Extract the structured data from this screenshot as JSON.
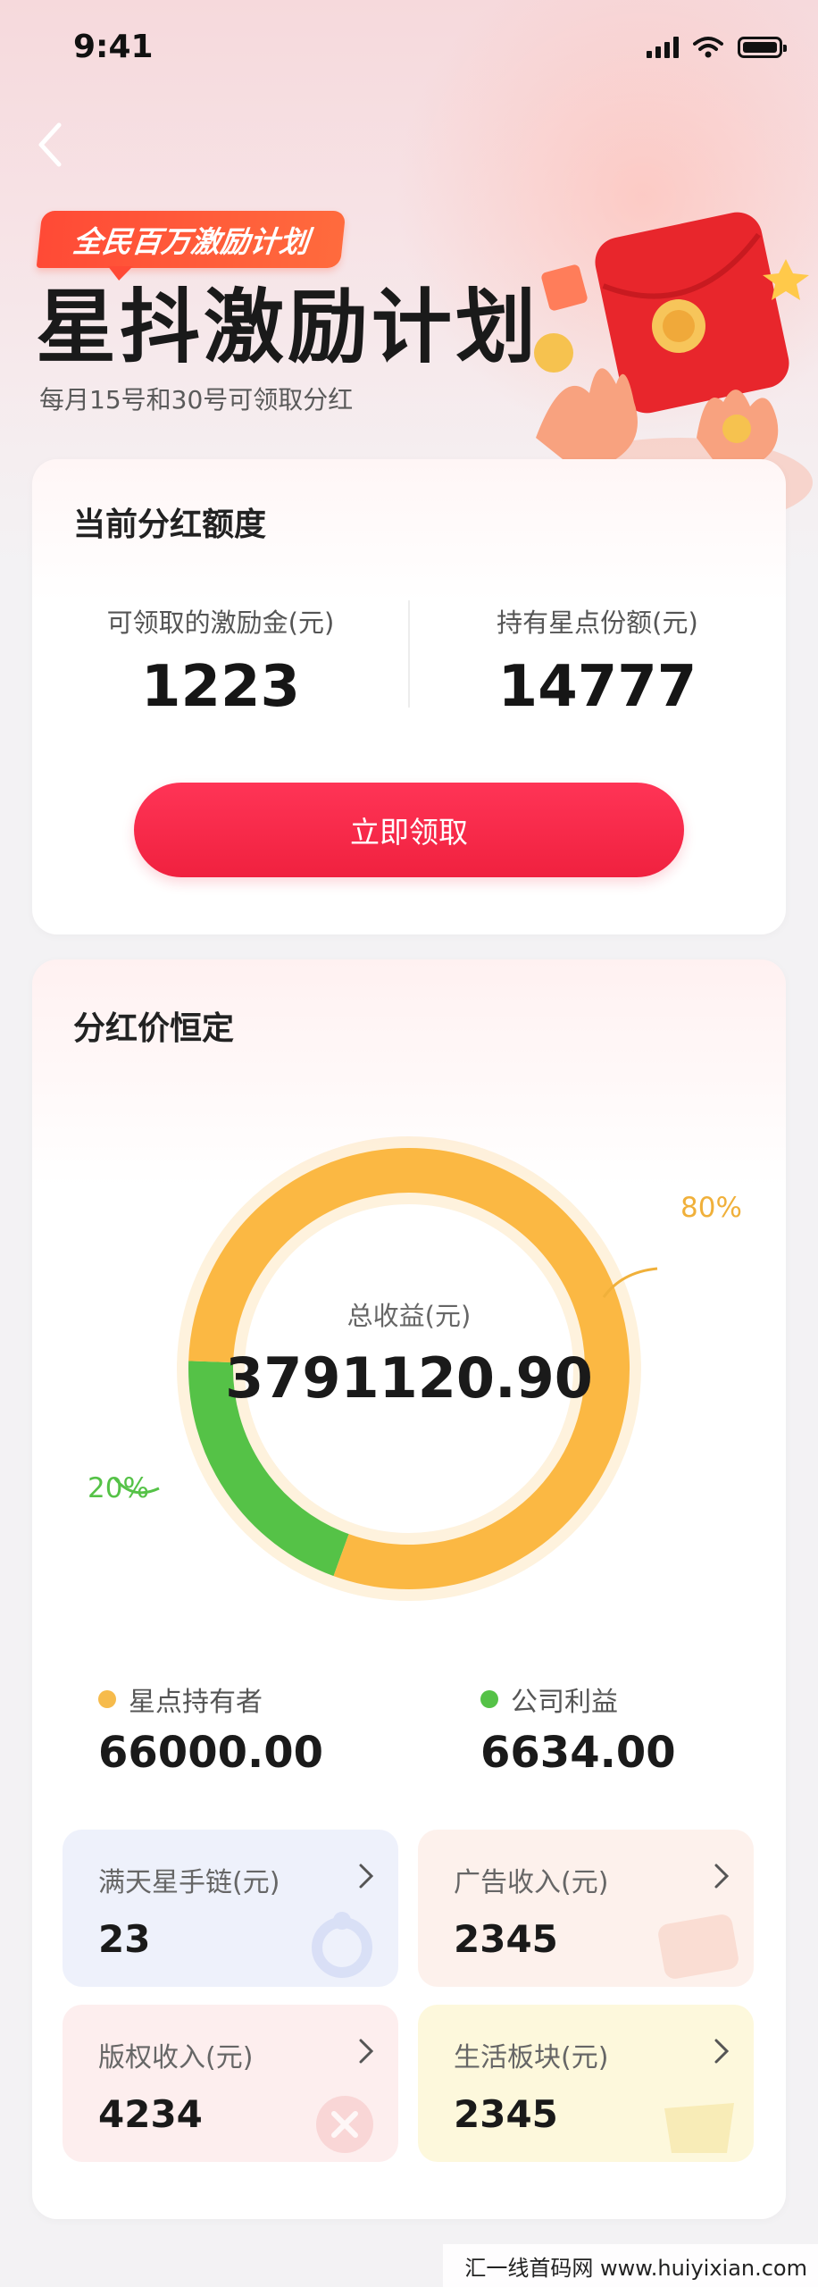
{
  "status_bar": {
    "time": "9:41"
  },
  "header": {
    "badge": "全民百万激励计划",
    "title": "星抖激励计划",
    "subtitle": "每月15号和30号可领取分红"
  },
  "dividend_card": {
    "title": "当前分红额度",
    "left_label": "可领取的激励金(元)",
    "left_value": "1223",
    "right_label": "持有星点份额(元)",
    "right_value": "14777",
    "button_label": "立即领取"
  },
  "price_card": {
    "title": "分红价恒定",
    "center_label": "总收益(元)",
    "center_value": "3791120.90",
    "segments": [
      {
        "label": "80%",
        "percent": 80,
        "color": "#fbb843"
      },
      {
        "label": "20%",
        "percent": 20,
        "color": "#55c247"
      }
    ],
    "legend": [
      {
        "name": "星点持有者",
        "value": "66000.00",
        "color": "#fbb843"
      },
      {
        "name": "公司利益",
        "value": "6634.00",
        "color": "#55c247"
      }
    ],
    "tiles": [
      {
        "label": "满天星手链(元)",
        "value": "23",
        "bg": "#eef1fb",
        "icon": "bracelet-icon"
      },
      {
        "label": "广告收入(元)",
        "value": "2345",
        "bg": "#fdf1ec",
        "icon": "ad-icon"
      },
      {
        "label": "版权收入(元)",
        "value": "4234",
        "bg": "#fdeeee",
        "icon": "copyright-icon"
      },
      {
        "label": "生活板块(元)",
        "value": "2345",
        "bg": "#fdf8dc",
        "icon": "life-icon"
      }
    ]
  },
  "watermark": "汇一线首码网 www.huiyixian.com"
}
